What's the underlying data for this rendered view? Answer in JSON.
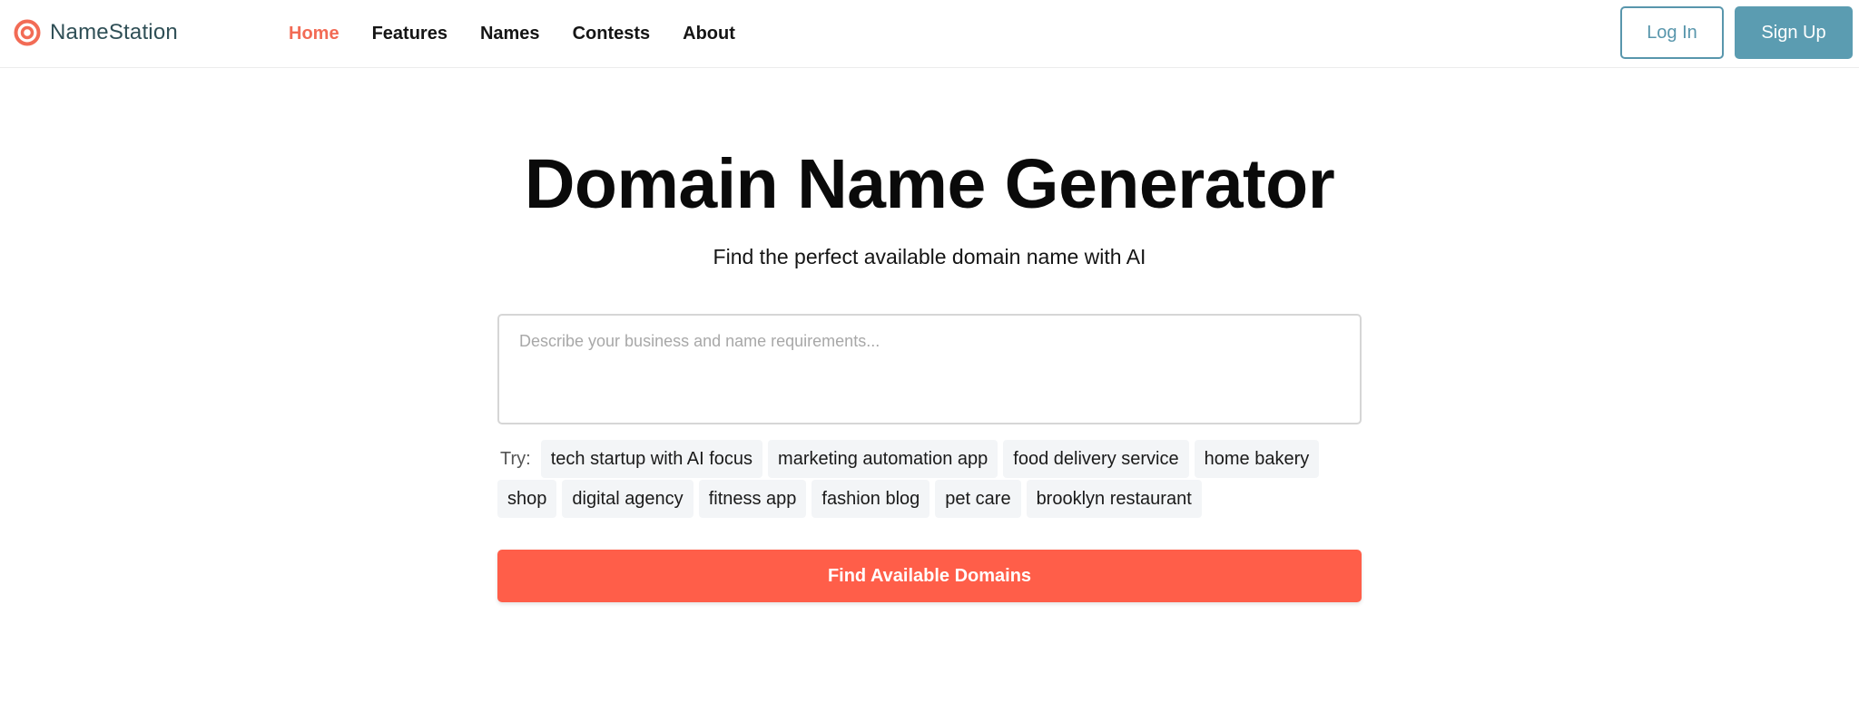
{
  "brand": {
    "name": "NameStation",
    "logo_icon": "target-icon",
    "accent": "#f26b55"
  },
  "nav": {
    "items": [
      {
        "label": "Home",
        "active": true
      },
      {
        "label": "Features",
        "active": false
      },
      {
        "label": "Names",
        "active": false
      },
      {
        "label": "Contests",
        "active": false
      },
      {
        "label": "About",
        "active": false
      }
    ]
  },
  "auth": {
    "login_label": "Log In",
    "signup_label": "Sign Up",
    "color": "#5b9cb1"
  },
  "hero": {
    "title": "Domain Name Generator",
    "subtitle": "Find the perfect available domain name with AI"
  },
  "search": {
    "value": "",
    "placeholder": "Describe your business and name requirements..."
  },
  "suggestions": {
    "label": "Try:",
    "row1": [
      "tech startup with AI focus",
      "marketing automation app",
      "food delivery service",
      "home bakery"
    ],
    "row2": [
      "shop",
      "digital agency",
      "fitness app",
      "fashion blog",
      "pet care",
      "brooklyn restaurant"
    ]
  },
  "cta": {
    "label": "Find Available Domains",
    "color": "#ff5e49"
  }
}
